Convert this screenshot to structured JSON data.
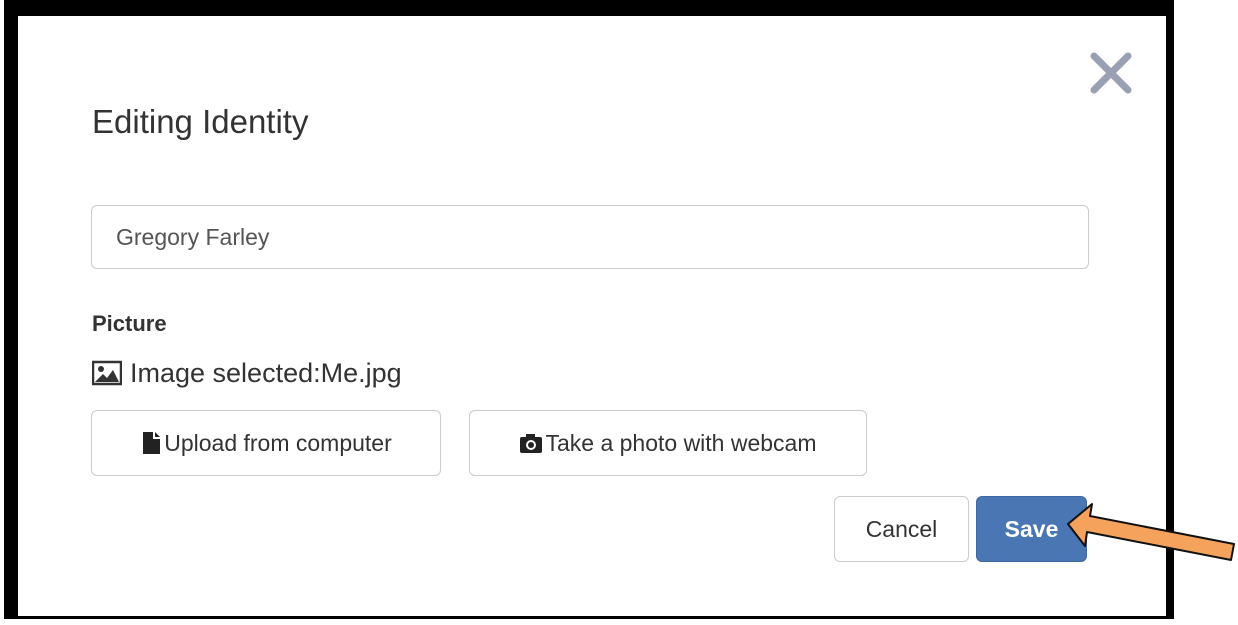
{
  "dialog": {
    "title": "Editing Identity",
    "name_value": "Gregory Farley",
    "picture_label": "Picture",
    "image_selected_text": "Image selected:Me.jpg",
    "upload_label": "Upload from computer",
    "webcam_label": "Take a photo with webcam",
    "cancel_label": "Cancel",
    "save_label": "Save"
  },
  "icons": {
    "close": "close-icon",
    "picture": "picture-icon",
    "file": "file-icon",
    "camera": "camera-icon",
    "annotation": "arrow-icon"
  },
  "colors": {
    "primary": "#4a77b4",
    "close": "#9aa0b3",
    "annotation_arrow": "#f5a25d"
  }
}
